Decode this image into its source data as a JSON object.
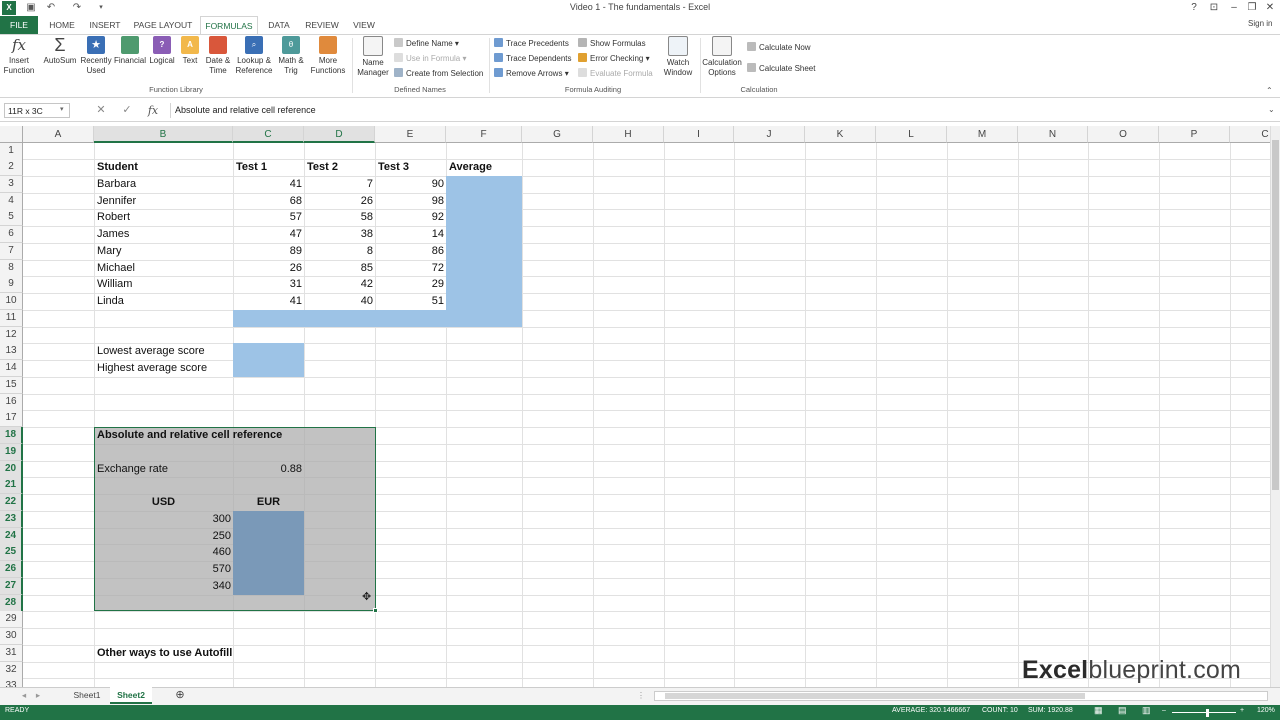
{
  "window": {
    "title": "Video 1 - The fundamentals - Excel",
    "help": "?",
    "signin": "Sign in"
  },
  "ribbon_tabs": [
    "FILE",
    "HOME",
    "INSERT",
    "PAGE LAYOUT",
    "FORMULAS",
    "DATA",
    "REVIEW",
    "VIEW"
  ],
  "ribbon": {
    "insert_function": "Insert Function",
    "autosum": "AutoSum",
    "recently_used": "Recently Used",
    "financial": "Financial",
    "logical": "Logical",
    "text": "Text",
    "date_time": "Date & Time",
    "lookup_ref": "Lookup & Reference",
    "math_trig": "Math & Trig",
    "more_functions": "More Functions",
    "function_library": "Function Library",
    "name_manager": "Name Manager",
    "define_name": "Define Name",
    "use_in_formula": "Use in Formula",
    "create_from_selection": "Create from Selection",
    "defined_names": "Defined Names",
    "trace_precedents": "Trace Precedents",
    "trace_dependents": "Trace Dependents",
    "remove_arrows": "Remove Arrows",
    "show_formulas": "Show Formulas",
    "error_checking": "Error Checking",
    "evaluate_formula": "Evaluate Formula",
    "watch_window": "Watch Window",
    "formula_auditing": "Formula Auditing",
    "calculation_options": "Calculation Options",
    "calculate_now": "Calculate Now",
    "calculate_sheet": "Calculate Sheet",
    "calculation": "Calculation"
  },
  "formula_bar": {
    "name_box": "11R x 3C",
    "content": "Absolute and relative cell reference"
  },
  "columns": [
    "A",
    "B",
    "C",
    "D",
    "E",
    "F",
    "G",
    "H",
    "I",
    "J",
    "K",
    "L",
    "M",
    "N",
    "O",
    "P",
    "C"
  ],
  "rows": [
    "1",
    "2",
    "3",
    "4",
    "5",
    "6",
    "7",
    "8",
    "9",
    "10",
    "11",
    "12",
    "13",
    "14",
    "15",
    "16",
    "17",
    "18",
    "19",
    "20",
    "21",
    "22",
    "23",
    "24",
    "25",
    "26",
    "27",
    "28",
    "29",
    "30",
    "31",
    "32",
    "33"
  ],
  "table": {
    "headers": [
      "Student",
      "Test 1",
      "Test 2",
      "Test 3",
      "Average"
    ],
    "students": [
      {
        "name": "Barbara",
        "t1": "41",
        "t2": "7",
        "t3": "90"
      },
      {
        "name": "Jennifer",
        "t1": "68",
        "t2": "26",
        "t3": "98"
      },
      {
        "name": "Robert",
        "t1": "57",
        "t2": "58",
        "t3": "92"
      },
      {
        "name": "James",
        "t1": "47",
        "t2": "38",
        "t3": "14"
      },
      {
        "name": "Mary",
        "t1": "89",
        "t2": "8",
        "t3": "86"
      },
      {
        "name": "Michael",
        "t1": "26",
        "t2": "85",
        "t3": "72"
      },
      {
        "name": "William",
        "t1": "31",
        "t2": "42",
        "t3": "29"
      },
      {
        "name": "Linda",
        "t1": "41",
        "t2": "40",
        "t3": "51"
      }
    ],
    "lowest_label": "Lowest average score",
    "highest_label": "Highest average score"
  },
  "exchange": {
    "title": "Absolute and relative cell reference",
    "rate_label": "Exchange rate",
    "rate_value": "0.88",
    "usd_header": "USD",
    "eur_header": "EUR",
    "usd_values": [
      "300",
      "250",
      "460",
      "570",
      "340"
    ]
  },
  "autofill_label": "Other ways to use Autofill",
  "sheets": [
    "Sheet1",
    "Sheet2"
  ],
  "status": {
    "ready": "READY",
    "average": "AVERAGE: 320.1466667",
    "count": "COUNT: 10",
    "sum": "SUM: 1920.88",
    "zoom": "120%"
  },
  "watermark": {
    "bold": "Excel",
    "rest": "blueprint.com"
  },
  "colors": {
    "excel_green": "#217346",
    "fill_blue": "#9dc3e6"
  }
}
